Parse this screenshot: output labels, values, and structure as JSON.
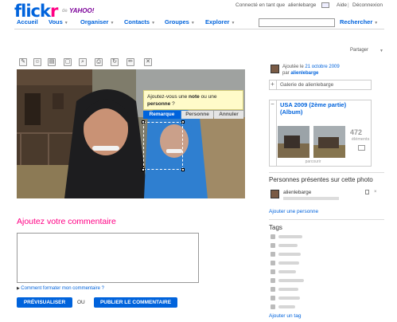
{
  "header": {
    "logo_main": "flick",
    "logo_r": "r",
    "logo_by": "de",
    "logo_yahoo": "YAHOO!",
    "connected_text": "Connecté en tant que",
    "username": "alienlebarge",
    "help": "Aide",
    "logout": "Déconnexion"
  },
  "nav": {
    "items": [
      {
        "label": "Accueil"
      },
      {
        "label": "Vous"
      },
      {
        "label": "Organiser"
      },
      {
        "label": "Contacts"
      },
      {
        "label": "Groupes"
      },
      {
        "label": "Explorer"
      }
    ],
    "search_label": "Rechercher",
    "search_value": ""
  },
  "share": {
    "label": "Partager"
  },
  "note_popup": {
    "text_before": "Ajoutez-vous une ",
    "bold_note": "note",
    "text_middle": " ou une ",
    "bold_person": "personne",
    "text_after": " ?",
    "btn_note": "Remarque",
    "btn_person": "Personne",
    "btn_cancel": "Annuler"
  },
  "comment": {
    "title": "Ajoutez votre commentaire",
    "format_link": "Comment formater mon commentaire ?",
    "preview_btn": "PRÉVISUALISER",
    "or": "OU",
    "publish_btn": "PUBLIER LE COMMENTAIRE"
  },
  "sidebar": {
    "added_prefix": "Ajoutée le",
    "added_date": "21 octobre 2009",
    "added_by": "par",
    "added_user": "alienlebarge",
    "gallery_label": "Galerie de alienlebarge",
    "album_title": "USA 2009 (2ème partie) (Album)",
    "album_count": "472",
    "album_count_label": "éléments",
    "album_nav": "parcourir",
    "people_title": "Personnes présentes sur cette photo",
    "person_name": "alienlebarge",
    "add_person": "Ajouter une personne",
    "tags_title": "Tags",
    "add_tag": "Ajouter un tag"
  },
  "colors": {
    "brand_blue": "#0063dc",
    "brand_pink": "#ff0084",
    "note_yellow": "#fffbc9"
  }
}
